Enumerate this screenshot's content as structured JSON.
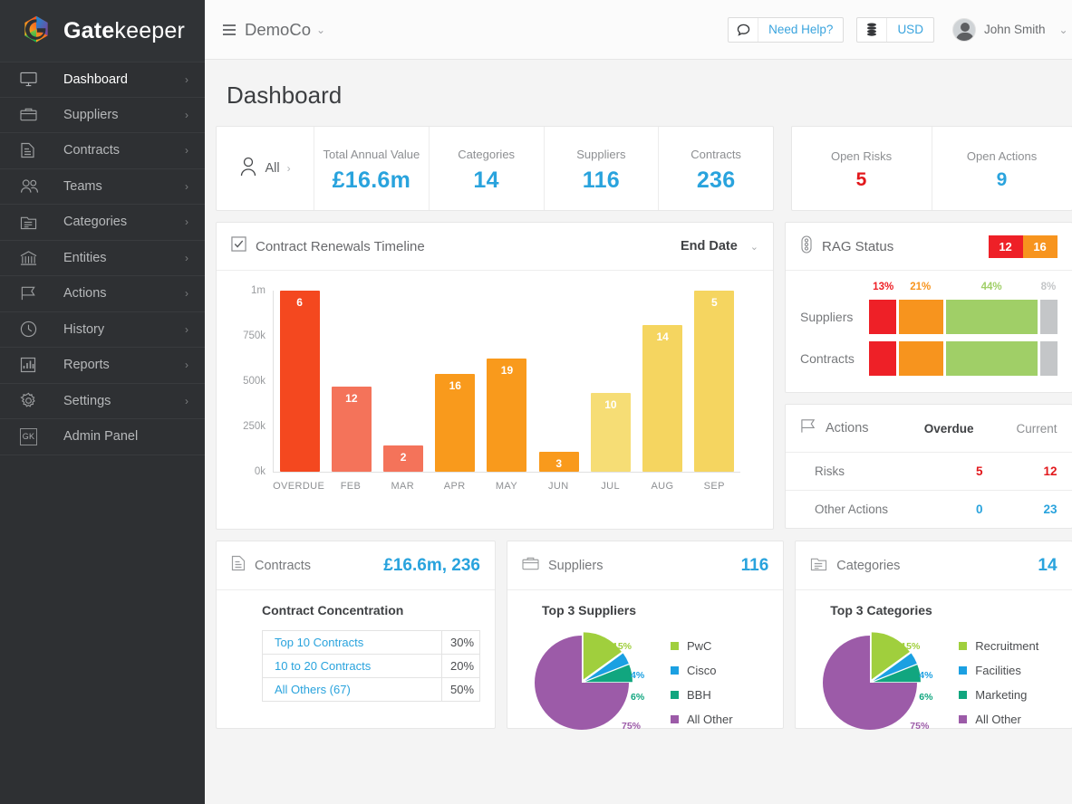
{
  "brand": {
    "name_bold": "Gate",
    "name_light": "keeper",
    "logo_icon": "gatekeeper-hex-logo"
  },
  "sidebar": {
    "items": [
      {
        "label": "Dashboard",
        "icon": "monitor-icon",
        "chevron": "›",
        "active": true
      },
      {
        "label": "Suppliers",
        "icon": "briefcase-icon",
        "chevron": "›",
        "active": false
      },
      {
        "label": "Contracts",
        "icon": "document-icon",
        "chevron": "›",
        "active": false
      },
      {
        "label": "Teams",
        "icon": "people-icon",
        "chevron": "›",
        "active": false
      },
      {
        "label": "Categories",
        "icon": "folder-list-icon",
        "chevron": "›",
        "active": false
      },
      {
        "label": "Entities",
        "icon": "bank-icon",
        "chevron": "›",
        "active": false
      },
      {
        "label": "Actions",
        "icon": "flag-icon",
        "chevron": "›",
        "active": false
      },
      {
        "label": "History",
        "icon": "clock-icon",
        "chevron": "›",
        "active": false
      },
      {
        "label": "Reports",
        "icon": "bar-chart-icon",
        "chevron": "›",
        "active": false
      },
      {
        "label": "Settings",
        "icon": "gear-icon",
        "chevron": "›",
        "active": false
      },
      {
        "label": "Admin Panel",
        "icon": "gk-badge-icon",
        "chevron": "",
        "active": false
      }
    ],
    "admin_badge_text": "GK"
  },
  "topbar": {
    "company": "DemoCo",
    "company_caret": "⌄",
    "help_label": "Need Help?",
    "help_icon": "speech-bubble-icon",
    "currency_label": "USD",
    "currency_icon": "database-icon",
    "user_name": "John Smith",
    "user_caret": "⌄",
    "avatar_icon": "user-avatar"
  },
  "page": {
    "title": "Dashboard"
  },
  "kpis": {
    "filter": {
      "label": "All",
      "icon": "person-icon",
      "chevron": "›"
    },
    "items": [
      {
        "label": "Total Annual Value",
        "value": "£16.6m",
        "color": "#29a3dd"
      },
      {
        "label": "Categories",
        "value": "14",
        "color": "#29a3dd"
      },
      {
        "label": "Suppliers",
        "value": "116",
        "color": "#29a3dd"
      },
      {
        "label": "Contracts",
        "value": "236",
        "color": "#29a3dd"
      }
    ],
    "items_right": [
      {
        "label": "Open Risks",
        "value": "5",
        "color": "#e2181c"
      },
      {
        "label": "Open Actions",
        "value": "9",
        "color": "#29a3dd"
      }
    ]
  },
  "timeline": {
    "title": "Contract Renewals Timeline",
    "icon": "checkbox-tick-icon",
    "dropdown_value": "End Date",
    "dropdown_chevron": "⌄"
  },
  "chart_data": {
    "type": "bar",
    "title": "Contract Renewals Timeline",
    "xlabel": "",
    "ylabel": "",
    "grid": false,
    "ylim": [
      0,
      1000000
    ],
    "ytick_labels": [
      "1m",
      "750k",
      "500k",
      "250k",
      "0k"
    ],
    "ytick_values": [
      1000000,
      750000,
      500000,
      250000,
      0
    ],
    "categories": [
      "OVERDUE",
      "FEB",
      "MAR",
      "APR",
      "MAY",
      "JUN",
      "JUL",
      "AUG",
      "SEP"
    ],
    "values": [
      1000000,
      470000,
      145000,
      540000,
      625000,
      110000,
      435000,
      810000,
      1005000
    ],
    "bar_labels": [
      "6",
      "12",
      "2",
      "16",
      "19",
      "3",
      "10",
      "14",
      "5"
    ],
    "bar_colors": [
      "#f4481f",
      "#f4735a",
      "#f4735a",
      "#f99a1c",
      "#f99a1c",
      "#f99a1c",
      "#f6dd75",
      "#f5d560",
      "#f5d560"
    ]
  },
  "rag": {
    "title": "RAG Status",
    "icon": "traffic-light-icon",
    "chips": [
      {
        "value": "12",
        "color": "#ee2027"
      },
      {
        "value": "16",
        "color": "#f7941e"
      }
    ],
    "percent_labels": [
      {
        "text": "13%",
        "color": "#ee2027"
      },
      {
        "text": "21%",
        "color": "#f7941e"
      },
      {
        "text": "44%",
        "color": "#a0cf67"
      },
      {
        "text": "8%",
        "color": "#c4c6c8"
      }
    ],
    "rows": [
      {
        "name": "Suppliers",
        "segments": [
          {
            "pct": 13,
            "color": "#ee2027"
          },
          {
            "pct": 21,
            "color": "#f7941e"
          },
          {
            "pct": 44,
            "color": "#a0cf67"
          },
          {
            "pct": 8,
            "color": "#c4c6c8"
          }
        ]
      },
      {
        "name": "Contracts",
        "segments": [
          {
            "pct": 13,
            "color": "#ee2027"
          },
          {
            "pct": 21,
            "color": "#f7941e"
          },
          {
            "pct": 44,
            "color": "#a0cf67"
          },
          {
            "pct": 8,
            "color": "#c4c6c8"
          }
        ]
      }
    ]
  },
  "actions": {
    "title": "Actions",
    "icon": "flag-icon",
    "col_overdue": "Overdue",
    "col_current": "Current",
    "rows": [
      {
        "label": "Risks",
        "overdue": "5",
        "current": "12",
        "overdue_color": "#e2181c",
        "current_color": "#e2181c"
      },
      {
        "label": "Other Actions",
        "overdue": "0",
        "current": "23",
        "overdue_color": "#29a3dd",
        "current_color": "#29a3dd"
      }
    ]
  },
  "contracts_card": {
    "title": "Contracts",
    "icon": "document-icon",
    "headline": "£16.6m, 236",
    "sub_title": "Contract Concentration",
    "rows": [
      {
        "name": "Top 10 Contracts",
        "pct": "30%"
      },
      {
        "name": "10 to 20 Contracts",
        "pct": "20%"
      },
      {
        "name": "All Others (67)",
        "pct": "50%"
      }
    ]
  },
  "suppliers_card": {
    "title": "Suppliers",
    "icon": "briefcase-icon",
    "headline": "116",
    "sub_title": "Top 3 Suppliers",
    "chart_data": {
      "type": "pie",
      "title": "Top 3 Suppliers",
      "labels": [
        "PwC",
        "Cisco",
        "BBH",
        "All Other"
      ],
      "values": [
        15,
        4,
        6,
        75
      ],
      "value_labels": [
        "15%",
        "4%",
        "6%",
        "75%"
      ],
      "colors": [
        "#a0cf3d",
        "#1ba0e2",
        "#11a67f",
        "#9c5ba8"
      ],
      "legend_position": "right"
    }
  },
  "categories_card": {
    "title": "Categories",
    "icon": "folder-list-icon",
    "headline": "14",
    "sub_title": "Top 3 Categories",
    "chart_data": {
      "type": "pie",
      "title": "Top 3 Categories",
      "labels": [
        "Recruitment",
        "Facilities",
        "Marketing",
        "All Other"
      ],
      "values": [
        15,
        4,
        6,
        75
      ],
      "value_labels": [
        "15%",
        "4%",
        "6%",
        "75%"
      ],
      "colors": [
        "#a0cf3d",
        "#1ba0e2",
        "#11a67f",
        "#9c5ba8"
      ],
      "legend_position": "right"
    }
  }
}
